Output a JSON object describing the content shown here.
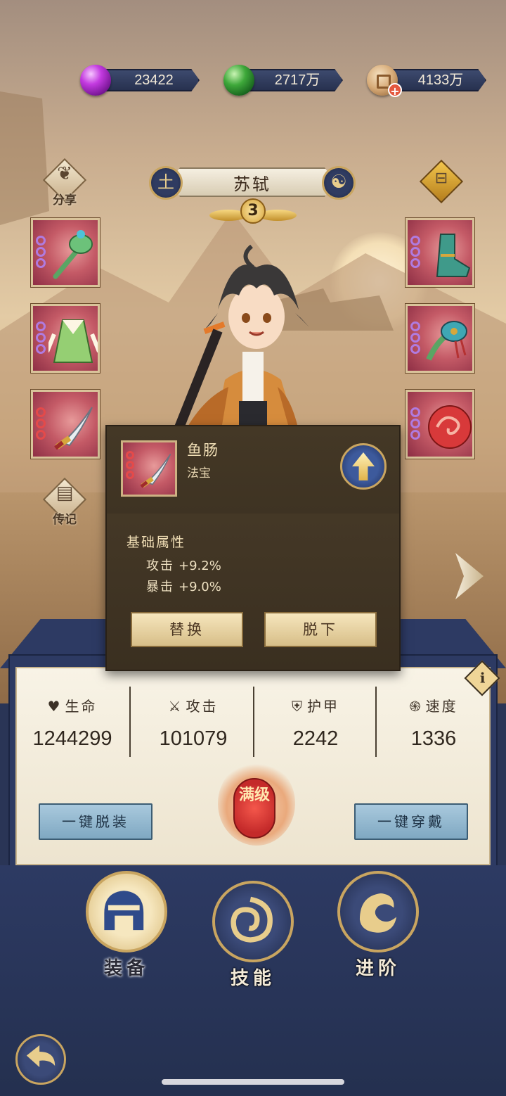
{
  "currencies": [
    {
      "icon": "purple-gem-icon",
      "value": "23422"
    },
    {
      "icon": "green-jade-icon",
      "value": "2717万"
    },
    {
      "icon": "copper-coin-icon",
      "value": "4133万",
      "has_add": true
    }
  ],
  "side_actions": {
    "share_label": "分享",
    "biography_label": "传记"
  },
  "hero": {
    "name": "苏轼",
    "element_glyph": "土",
    "star_level": "3"
  },
  "equipment_slots": {
    "left": [
      "jade-scepter-icon",
      "green-robe-icon",
      "dagger-icon"
    ],
    "right": [
      "boots-icon",
      "charm-pendant-icon",
      "red-pearl-icon"
    ]
  },
  "popup": {
    "item_name": "鱼肠",
    "item_type": "法宝",
    "section_title": "基础属性",
    "attributes": [
      {
        "name": "攻击",
        "value": "+9.2%"
      },
      {
        "name": "暴击",
        "value": "+9.0%"
      }
    ],
    "replace_label": "替换",
    "remove_label": "脱下"
  },
  "stats": [
    {
      "icon": "heart-icon",
      "label": "生命",
      "value": "1244299"
    },
    {
      "icon": "crossed-swords-icon",
      "label": "攻击",
      "value": "101079"
    },
    {
      "icon": "shield-icon",
      "label": "护甲",
      "value": "2242"
    },
    {
      "icon": "swirl-icon",
      "label": "速度",
      "value": "1336"
    }
  ],
  "info_glyph": "i",
  "max_level_label": "满级",
  "unequip_all_label": "一键脱装",
  "equip_all_label": "一键穿戴",
  "bottom_nav": [
    {
      "label": "装备",
      "active": true
    },
    {
      "label": "技能",
      "active": false
    },
    {
      "label": "进阶",
      "active": false
    }
  ],
  "colors": {
    "panel_navy": "#2d3a63",
    "gold_trim": "#c9a560",
    "slot_crimson": "#c45a66"
  }
}
